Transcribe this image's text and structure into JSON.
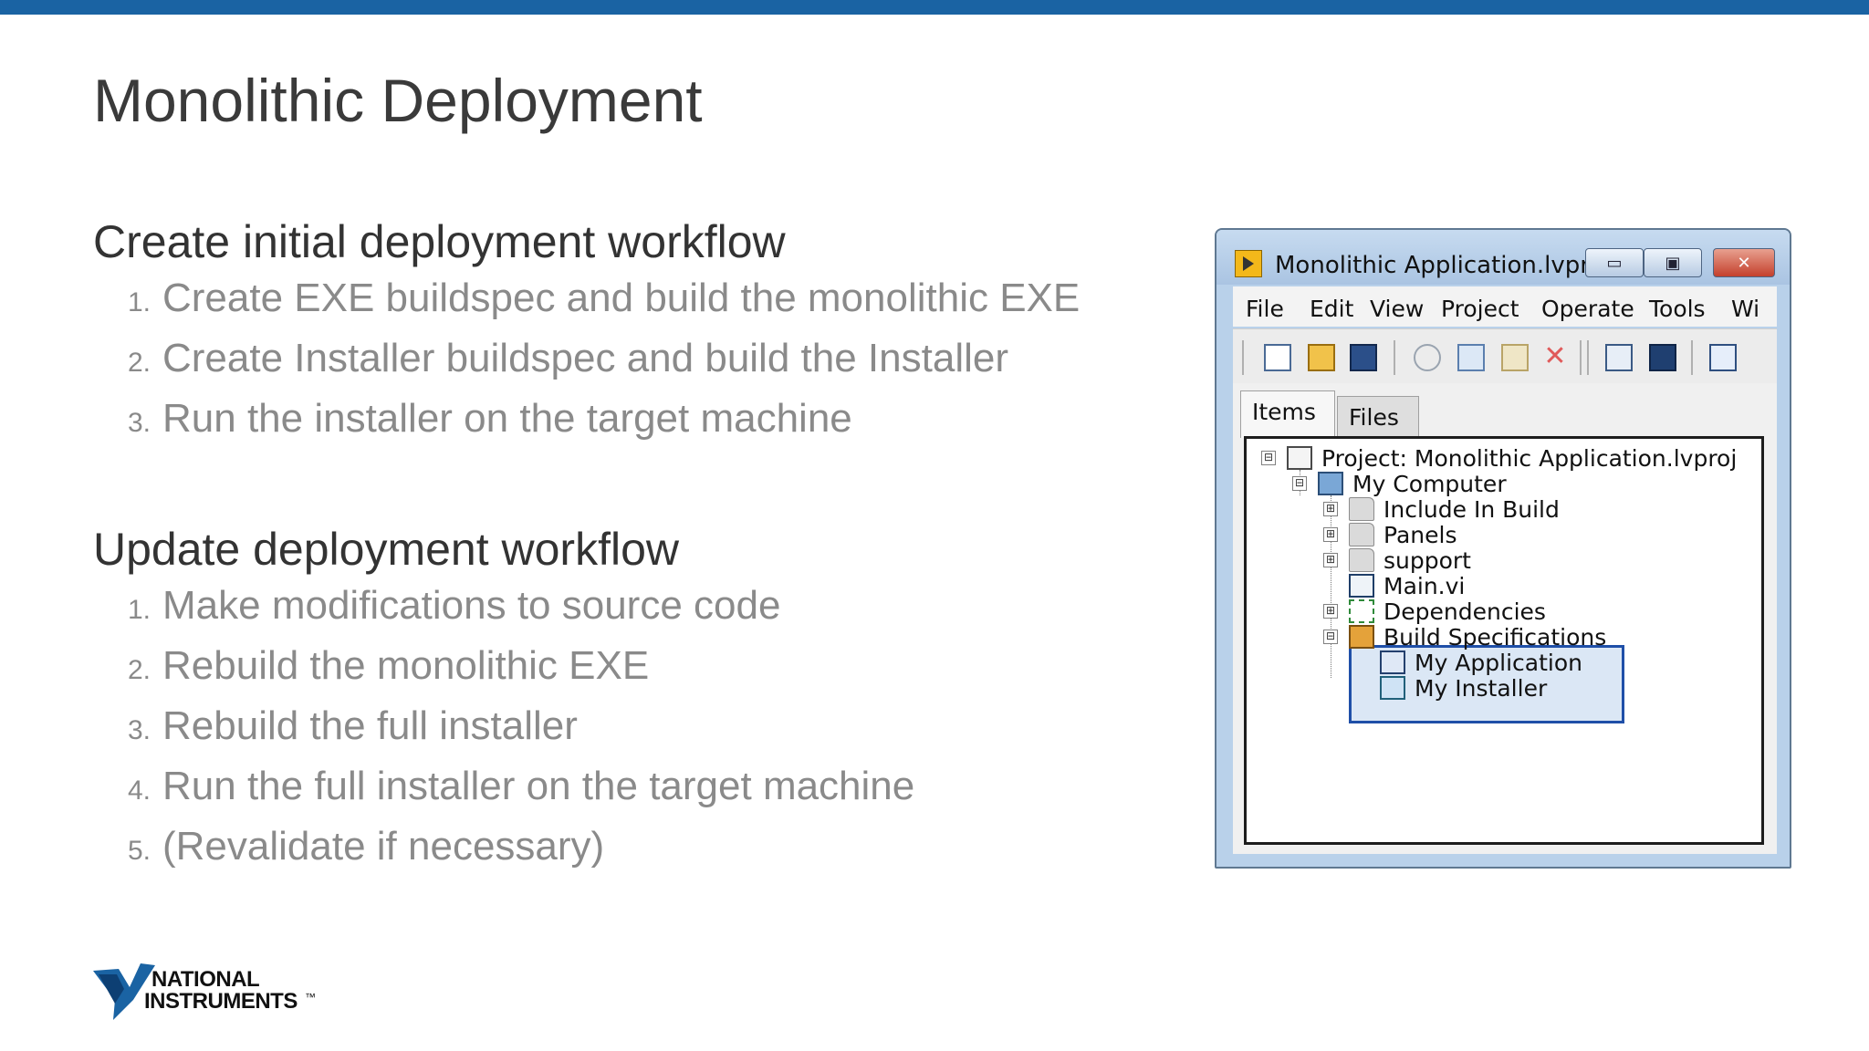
{
  "slide": {
    "title": "Monolithic Deployment",
    "initial": {
      "heading": "Create initial deployment workflow",
      "steps": [
        {
          "num": "1.",
          "text": "Create EXE buildspec and build the monolithic EXE"
        },
        {
          "num": "2.",
          "text": "Create Installer buildspec and build the Installer"
        },
        {
          "num": "3.",
          "text": "Run the installer on the target machine"
        }
      ]
    },
    "update": {
      "heading": "Update deployment workflow",
      "steps": [
        {
          "num": "1.",
          "text": "Make modifications to source code"
        },
        {
          "num": "2.",
          "text": "Rebuild the monolithic EXE"
        },
        {
          "num": "3.",
          "text": "Rebuild the full installer"
        },
        {
          "num": "4.",
          "text": "Run the full installer on the target machine"
        },
        {
          "num": "5.",
          "text": "(Revalidate if necessary)"
        }
      ]
    }
  },
  "window": {
    "title": "Monolithic Application.lvpr...",
    "menu": [
      "File",
      "Edit",
      "View",
      "Project",
      "Operate",
      "Tools",
      "Wi"
    ],
    "tabs": {
      "items": "Items",
      "files": "Files"
    },
    "tree": [
      {
        "label": "Project: Monolithic Application.lvproj",
        "icon": "project-icon",
        "expander": "⊟"
      },
      {
        "label": "My Computer",
        "icon": "computer-icon",
        "expander": "⊟"
      },
      {
        "label": "Include In Build",
        "icon": "folder-icon",
        "expander": "⊞"
      },
      {
        "label": "Panels",
        "icon": "folder-icon",
        "expander": "⊞"
      },
      {
        "label": "support",
        "icon": "folder-icon",
        "expander": "⊞"
      },
      {
        "label": "Main.vi",
        "icon": "vi-icon",
        "expander": ""
      },
      {
        "label": "Dependencies",
        "icon": "dependencies-icon",
        "expander": "⊞"
      },
      {
        "label": "Build Specifications",
        "icon": "build-specifications-icon",
        "expander": "⊟"
      },
      {
        "label": "My Application",
        "icon": "application-icon",
        "expander": ""
      },
      {
        "label": "My Installer",
        "icon": "installer-icon",
        "expander": ""
      }
    ]
  },
  "logo": {
    "line1": "NATIONAL",
    "line2": "INSTRUMENTS",
    "tm": "™"
  },
  "colors": {
    "top_bar": "#1a63a3",
    "selection_border": "#1f4fa8"
  }
}
